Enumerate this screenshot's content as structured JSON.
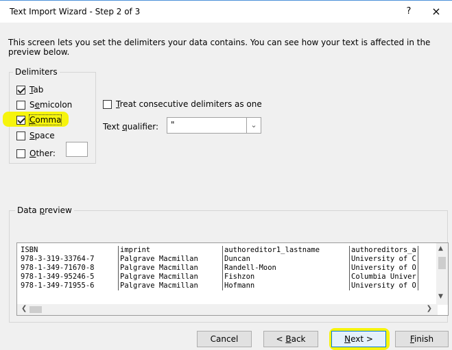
{
  "window": {
    "title": "Text Import Wizard - Step 2 of 3",
    "help_label": "?",
    "close_label": "×"
  },
  "description": "This screen lets you set the delimiters your data contains.  You can see how your text is affected in the preview below.",
  "delimiters": {
    "group_label": "Delimiters",
    "items": [
      {
        "key": "T",
        "rest": "ab",
        "checked": true
      },
      {
        "key": "Semi",
        "rest": "colon",
        "prefix": "",
        "checked": false
      },
      {
        "key": "C",
        "rest": "omma",
        "checked": true,
        "highlighted": true
      },
      {
        "key": "S",
        "rest": "pace",
        "checked": false
      },
      {
        "key": "O",
        "rest": "ther:",
        "checked": false
      }
    ],
    "other_value": ""
  },
  "options": {
    "consecutive_key": "T",
    "consecutive_rest": "reat consecutive delimiters as one",
    "consecutive_checked": false,
    "qualifier_prefix": "Text ",
    "qualifier_key": "q",
    "qualifier_rest": "ualifier:",
    "qualifier_value": "\"",
    "dropdown_icon": "chevron-down-icon"
  },
  "preview": {
    "label_prefix": "Data ",
    "label_key": "p",
    "label_rest": "review",
    "rows": [
      [
        "ISBN",
        "imprint",
        "authoreditor1_lastname",
        "authoreditors_a"
      ],
      [
        "978-3-319-33764-7",
        "Palgrave Macmillan",
        "Duncan",
        "University of C"
      ],
      [
        "978-1-349-71670-8",
        "Palgrave Macmillan",
        "Randell-Moon",
        "University of O"
      ],
      [
        "978-1-349-95246-5",
        "Palgrave Macmillan",
        "Fishzon",
        "Columbia Univer"
      ],
      [
        "978-1-349-71955-6",
        "Palgrave Macmillan",
        "Hofmann",
        "University of O"
      ]
    ]
  },
  "buttons": {
    "cancel": "Cancel",
    "back_prefix": "< ",
    "back_key": "B",
    "back_rest": "ack",
    "next_key": "N",
    "next_rest": "ext >",
    "finish_key": "F",
    "finish_rest": "inish"
  },
  "colors": {
    "highlight": "#f6f300",
    "accent": "#0078d7"
  }
}
